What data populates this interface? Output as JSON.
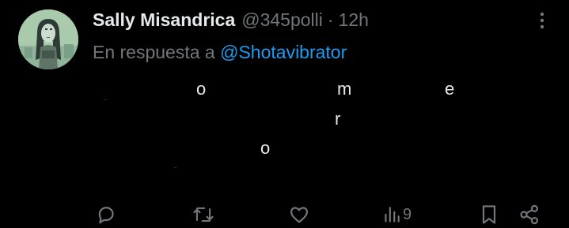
{
  "tweet": {
    "display_name": "Sally Misandrica",
    "handle": "@345polli",
    "separator": "·",
    "time": "12h",
    "reply_prefix": "En respuesta a",
    "reply_to": "@Shotavibrator",
    "body_chars": [
      "o",
      "m",
      "e",
      "r",
      "o"
    ]
  },
  "actions": {
    "reply_icon": "reply-icon",
    "retweet_icon": "retweet-icon",
    "like_icon": "heart-icon",
    "views_icon": "views-icon",
    "views_count": "9",
    "bookmark_icon": "bookmark-icon",
    "share_icon": "share-icon"
  },
  "colors": {
    "background": "#000000",
    "text": "#e7e9ea",
    "secondary": "#71767b",
    "link": "#1d9bf0"
  }
}
